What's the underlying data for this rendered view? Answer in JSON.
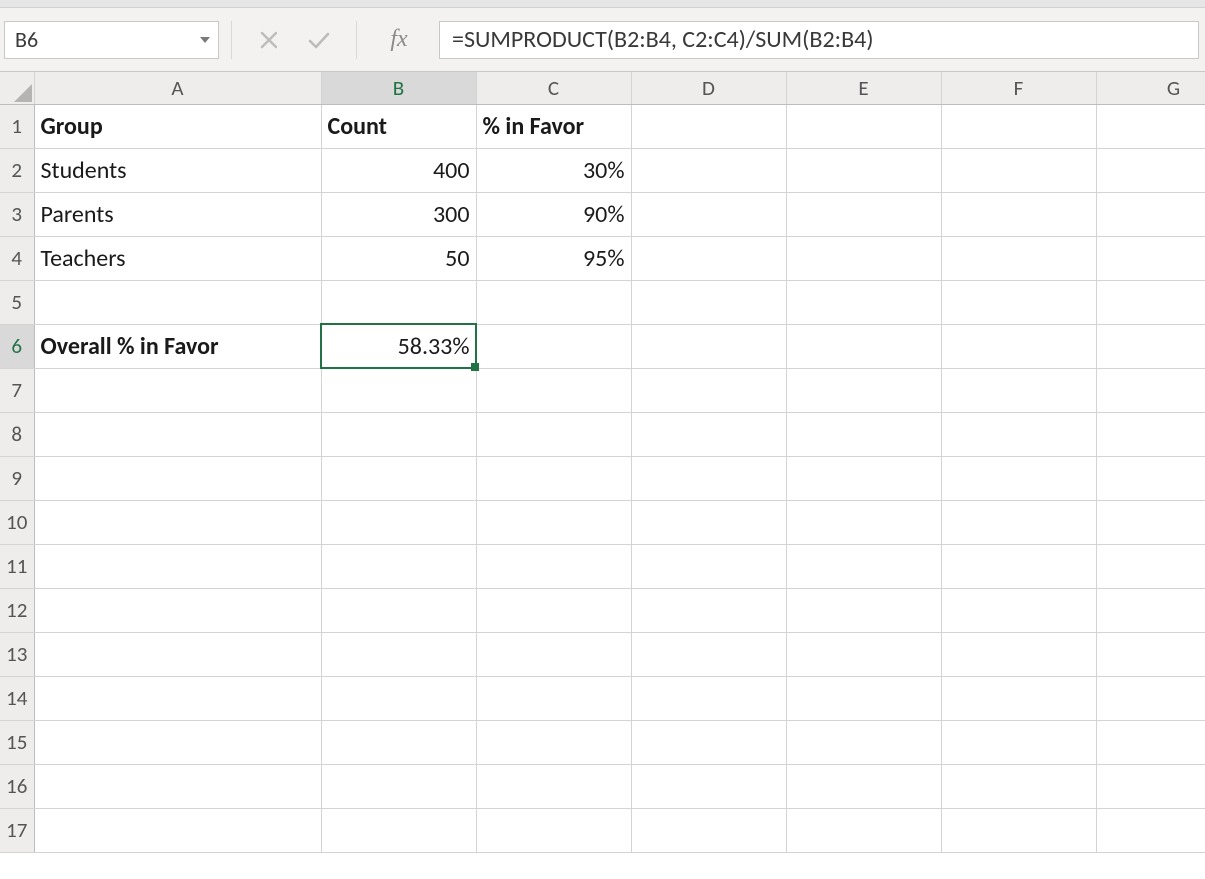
{
  "nameBox": {
    "value": "B6"
  },
  "formulaBar": {
    "fxLabel": "fx",
    "formula": "=SUMPRODUCT(B2:B4, C2:C4)/SUM(B2:B4)"
  },
  "columns": [
    "A",
    "B",
    "C",
    "D",
    "E",
    "F",
    "G"
  ],
  "rowCount": 17,
  "selectedCell": {
    "col": "B",
    "row": 6
  },
  "cells": {
    "A1": {
      "v": "Group",
      "bold": true,
      "align": "left"
    },
    "B1": {
      "v": "Count",
      "bold": true,
      "align": "left"
    },
    "C1": {
      "v": "% in Favor",
      "bold": true,
      "align": "left"
    },
    "A2": {
      "v": "Students",
      "align": "left"
    },
    "B2": {
      "v": "400",
      "align": "right"
    },
    "C2": {
      "v": "30%",
      "align": "right"
    },
    "A3": {
      "v": "Parents",
      "align": "left"
    },
    "B3": {
      "v": "300",
      "align": "right"
    },
    "C3": {
      "v": "90%",
      "align": "right"
    },
    "A4": {
      "v": "Teachers",
      "align": "left"
    },
    "B4": {
      "v": "50",
      "align": "right"
    },
    "C4": {
      "v": "95%",
      "align": "right"
    },
    "A6": {
      "v": "Overall % in Favor",
      "bold": true,
      "align": "left"
    },
    "B6": {
      "v": "58.33%",
      "align": "right"
    }
  },
  "colors": {
    "selectionBorder": "#217346"
  }
}
